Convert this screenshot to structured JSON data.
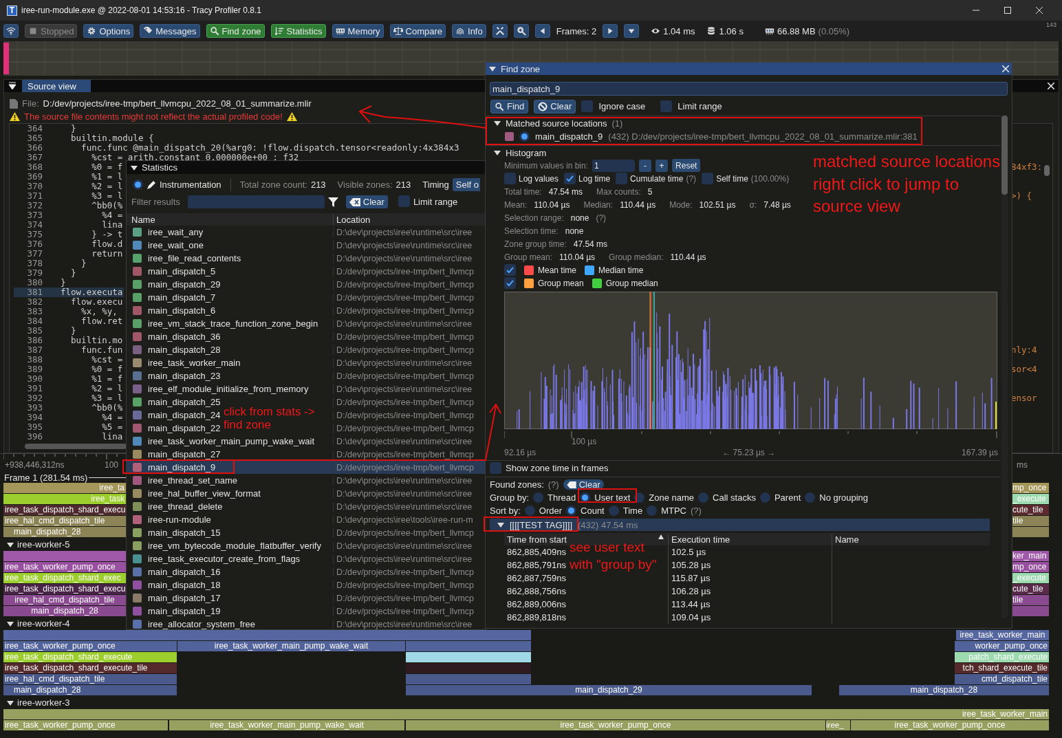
{
  "window": {
    "app_icon": "T",
    "title": "iree-run-module.exe @ 2022-08-01 14:53:16 - Tracy Profiler 0.8.1"
  },
  "toolbar": {
    "buttons": [
      {
        "kind": "icon",
        "active": false
      },
      {
        "kind": "label",
        "label": "Stopped",
        "active": false,
        "disabled": true
      },
      {
        "kind": "label",
        "label": "Options",
        "active": false
      },
      {
        "kind": "label",
        "label": "Messages",
        "active": false
      },
      {
        "kind": "label",
        "label": "Find zone",
        "active": true
      },
      {
        "kind": "label",
        "label": "Statistics",
        "active": true
      },
      {
        "kind": "label",
        "label": "Memory",
        "active": false
      },
      {
        "kind": "label",
        "label": "Compare",
        "active": false
      },
      {
        "kind": "label",
        "label": "Info",
        "active": false
      },
      {
        "kind": "icon",
        "active": false
      },
      {
        "kind": "icon",
        "active": false
      }
    ],
    "frames": "Frames: 2",
    "frame_time": "1.04 ms",
    "total_time": "1.06 s",
    "memory": "66.88 MB",
    "memory_share": "(0.05%)",
    "fps": "143"
  },
  "source_view": {
    "tab": "Source view",
    "file_label": "File:",
    "file_path": "D:/dev/projects/iree-tmp/bert_llvmcpu_2022_08_01_summarize.mlir",
    "warning": "The source file contents might not reflect the actual profiled code!",
    "lines": [
      {
        "number": "364",
        "code": "  }",
        "selected": false
      },
      {
        "number": "365",
        "code": "  builtin.module {",
        "selected": false
      },
      {
        "number": "366",
        "code": "    func.func @main_dispatch_20(%arg0: !flow.dispatch.tensor<readonly:4x384x3",
        "selected": false
      },
      {
        "number": "367",
        "code": "      %cst = arith.constant 0.000000e+00 : f32",
        "selected": false
      },
      {
        "number": "368",
        "code": "      %0 = f",
        "tail": "84xf3:",
        "selected": false
      },
      {
        "number": "369",
        "code": "      %1 = l",
        "selected": false
      },
      {
        "number": "370",
        "code": "      %2 = l",
        "selected": false
      },
      {
        "number": "371",
        "code": "      %3 = l",
        "tail": ">) {",
        "selected": false
      },
      {
        "number": "372",
        "code": "      ^bb0(%",
        "selected": false
      },
      {
        "number": "373",
        "code": "        %4 =",
        "selected": false
      },
      {
        "number": "374",
        "code": "        lina",
        "selected": false
      },
      {
        "number": "375",
        "code": "      } -> t",
        "selected": false
      },
      {
        "number": "376",
        "code": "      flow.d",
        "selected": false
      },
      {
        "number": "377",
        "code": "      return",
        "selected": false
      },
      {
        "number": "378",
        "code": "    }",
        "selected": false
      },
      {
        "number": "379",
        "code": "  }",
        "selected": false
      },
      {
        "number": "380",
        "code": "}",
        "selected": false
      },
      {
        "number": "381",
        "code": "flow.executa",
        "selected": true
      },
      {
        "number": "382",
        "code": "  flow.execu",
        "selected": false
      },
      {
        "number": "383",
        "code": "    %x, %y,",
        "selected": false
      },
      {
        "number": "384",
        "code": "    flow.ret",
        "selected": false
      },
      {
        "number": "385",
        "code": "  }",
        "selected": false
      },
      {
        "number": "386",
        "code": "  builtin.mo",
        "selected": false
      },
      {
        "number": "387",
        "code": "    func.fun",
        "tail": "nly:4",
        "selected": false
      },
      {
        "number": "388",
        "code": "      %cst =",
        "selected": false
      },
      {
        "number": "389",
        "code": "      %0 = f",
        "tail": "sor<4",
        "selected": false
      },
      {
        "number": "390",
        "code": "      %1 = f",
        "selected": false
      },
      {
        "number": "391",
        "code": "      %2 = l",
        "selected": false
      },
      {
        "number": "392",
        "code": "      %3 = l",
        "tail": "ensor",
        "selected": false
      },
      {
        "number": "393",
        "code": "      ^bb0(%",
        "selected": false
      },
      {
        "number": "394",
        "code": "        %4 =",
        "selected": false
      },
      {
        "number": "395",
        "code": "        %5 =",
        "selected": false
      },
      {
        "number": "396",
        "code": "        lina",
        "selected": false
      }
    ]
  },
  "statistics": {
    "title": "Statistics",
    "mode": {
      "label": "Instrumentation",
      "selected": true
    },
    "total_label": "Total zone count:",
    "total": "213",
    "visible_label": "Visible zones:",
    "visible": "213",
    "timing_label": "Timing",
    "timing_button": "Self o",
    "filter_label": "Filter results",
    "clear": "Clear",
    "limit_range": {
      "label": "Limit range",
      "checked": false
    },
    "columns": [
      "Name",
      "Location"
    ],
    "rows": [
      {
        "name": "iree_wait_any",
        "location": "D:\\dev\\projects\\iree\\runtime\\src\\iree",
        "color": "#5aa084",
        "selected": false
      },
      {
        "name": "iree_wait_one",
        "location": "D:\\dev\\projects\\iree\\runtime\\src\\iree",
        "color": "#5088b8",
        "selected": false
      },
      {
        "name": "iree_file_read_contents",
        "location": "D:\\dev\\projects\\iree\\runtime\\src\\iree",
        "color": "#58a06c",
        "selected": false
      },
      {
        "name": "main_dispatch_5",
        "location": "D:/dev/projects/iree-tmp/bert_llvmcp",
        "color": "#a05868",
        "selected": false
      },
      {
        "name": "main_dispatch_29",
        "location": "D:/dev/projects/iree-tmp/bert_llvmcp",
        "color": "#58a068",
        "selected": false
      },
      {
        "name": "main_dispatch_7",
        "location": "D:/dev/projects/iree-tmp/bert_llvmcp",
        "color": "#58a068",
        "selected": false
      },
      {
        "name": "main_dispatch_6",
        "location": "D:/dev/projects/iree-tmp/bert_llvmcp",
        "color": "#a05868",
        "selected": false
      },
      {
        "name": "iree_vm_stack_trace_function_zone_begin",
        "location": "D:\\dev\\projects\\iree\\runtime\\src\\iree",
        "color": "#58a068",
        "selected": false
      },
      {
        "name": "main_dispatch_36",
        "location": "D:/dev/projects/iree-tmp/bert_llvmcp",
        "color": "#a05868",
        "selected": false
      },
      {
        "name": "main_dispatch_28",
        "location": "D:/dev/projects/iree-tmp/bert_llvmcp",
        "color": "#7a6080",
        "selected": false
      },
      {
        "name": "iree_task_worker_main",
        "location": "D:\\dev\\projects\\iree\\runtime\\src\\iree",
        "color": "#9a8a70",
        "selected": false
      },
      {
        "name": "main_dispatch_23",
        "location": "D:/dev/projects/iree-tmp/bert_llvmcp",
        "color": "#5a7090",
        "selected": false
      },
      {
        "name": "iree_elf_module_initialize_from_memory",
        "location": "D:\\dev\\projects\\iree\\runtime\\src\\iree",
        "color": "#7a6088",
        "selected": false
      },
      {
        "name": "main_dispatch_25",
        "location": "D:/dev/projects/iree-tmp/bert_llvmcp",
        "color": "#58a068",
        "selected": false
      },
      {
        "name": "main_dispatch_24",
        "location": "D:/dev/projects/iree-tmp/bert_llvmcp",
        "color": "#6a6a98",
        "selected": false
      },
      {
        "name": "main_dispatch_22",
        "location": "D:/dev/projects/iree-tmp/bert_llvmcp",
        "color": "#a05870",
        "selected": false
      },
      {
        "name": "iree_task_worker_main_pump_wake_wait",
        "location": "D:\\dev\\projects\\iree\\runtime\\src\\iree",
        "color": "#5088b8",
        "selected": false
      },
      {
        "name": "main_dispatch_27",
        "location": "D:/dev/projects/iree-tmp/bert_llvmcp",
        "color": "#9a8a60",
        "selected": false
      },
      {
        "name": "main_dispatch_9",
        "location": "D:/dev/projects/iree-tmp/bert_llvmcp",
        "color": "#b0607a",
        "selected": true
      },
      {
        "name": "iree_thread_set_name",
        "location": "D:\\dev\\projects\\iree\\runtime\\src\\iree",
        "color": "#a05880",
        "selected": false
      },
      {
        "name": "iree_hal_buffer_view_format",
        "location": "D:\\dev\\projects\\iree\\runtime\\src\\iree",
        "color": "#9a8a60",
        "selected": false
      },
      {
        "name": "iree_thread_delete",
        "location": "D:\\dev\\projects\\iree\\runtime\\src\\iree",
        "color": "#80905a",
        "selected": false
      },
      {
        "name": "iree-run-module",
        "location": "D:\\dev\\projects\\iree\\tools\\iree-run-m",
        "color": "#b0607a",
        "selected": false
      },
      {
        "name": "main_dispatch_15",
        "location": "D:/dev/projects/iree-tmp/bert_llvmcp",
        "color": "#8aa060",
        "selected": false
      },
      {
        "name": "iree_vm_bytecode_module_flatbuffer_verify",
        "location": "D:\\dev\\projects\\iree\\runtime\\src\\iree",
        "color": "#8aa060",
        "selected": false
      },
      {
        "name": "iree_task_executor_create_from_flags",
        "location": "D:\\dev\\projects\\iree\\runtime\\src\\iree",
        "color": "#4a9090",
        "selected": false
      },
      {
        "name": "main_dispatch_16",
        "location": "D:/dev/projects/iree-tmp/bert_llvmcp",
        "color": "#5a70a8",
        "selected": false
      },
      {
        "name": "main_dispatch_18",
        "location": "D:/dev/projects/iree-tmp/bert_llvmcp",
        "color": "#9050a0",
        "selected": false
      },
      {
        "name": "main_dispatch_17",
        "location": "D:/dev/projects/iree-tmp/bert_llvmcp",
        "color": "#8a7a68",
        "selected": false
      },
      {
        "name": "main_dispatch_19",
        "location": "D:/dev/projects/iree-tmp/bert_llvmcp",
        "color": "#9050a0",
        "selected": false
      },
      {
        "name": "iree_allocator_system_free",
        "location": "D:\\dev\\projects\\iree\\runtime\\src\\iree",
        "color": "#5a70a8",
        "selected": false
      }
    ]
  },
  "find_zone": {
    "title": "Find zone",
    "query": "main_dispatch_9",
    "find": "Find",
    "clear": "Clear",
    "ignore_case": {
      "label": "Ignore case",
      "checked": false
    },
    "limit_range": {
      "label": "Limit range",
      "checked": false
    },
    "matched": {
      "label": "Matched source locations",
      "count": "(1)",
      "expanded": true,
      "items": [
        {
          "name": "main_dispatch_9",
          "detail": "(432) D:/dev/projects/iree-tmp/bert_llvmcpu_2022_08_01_summarize.mlir:381",
          "color": "#a05a80",
          "selected": true
        }
      ]
    },
    "histogram": {
      "label": "Histogram",
      "expanded": true,
      "min_label": "Minimum values in bin:",
      "min_value": "1",
      "minus": "-",
      "plus": "+",
      "reset": "Reset",
      "options": [
        {
          "label": "Log values",
          "checked": false
        },
        {
          "label": "Log time",
          "checked": true
        },
        {
          "label": "Cumulate time",
          "checked": false,
          "hint": "(?)"
        },
        {
          "label": "Self time",
          "checked": false,
          "hint": "(100.00%)"
        }
      ],
      "stats": [
        [
          {
            "label": "Total time:",
            "value": "47.54 ms"
          },
          {
            "label": "Max counts:",
            "value": "5"
          }
        ],
        [
          {
            "label": "Mean:",
            "value": "110.04 µs"
          },
          {
            "label": "Median:",
            "value": "110.44 µs"
          },
          {
            "label": "Mode:",
            "value": "102.51 µs"
          },
          {
            "label": "σ:",
            "value": "7.48 µs"
          }
        ],
        [
          {
            "label": "Selection range:",
            "value": "none",
            "hint": "(?)"
          }
        ],
        [
          {
            "label": "Selection time:",
            "value": "none"
          }
        ],
        [
          {
            "label": "Zone group time:",
            "value": "47.54 ms"
          }
        ],
        [
          {
            "label": "Group mean:",
            "value": "110.04 µs"
          },
          {
            "label": "Group median:",
            "value": "110.44 µs"
          }
        ]
      ],
      "legend": [
        {
          "checked": true,
          "items": [
            {
              "label": "Mean time",
              "color": "#ff4a4a"
            },
            {
              "label": "Median time",
              "color": "#40a8ff"
            }
          ]
        },
        {
          "checked": true,
          "items": [
            {
              "label": "Group mean",
              "color": "#ffa040"
            },
            {
              "label": "Group median",
              "color": "#40d040"
            }
          ]
        }
      ],
      "tick": "100 µs",
      "min": "92.16 µs",
      "range": "← 75.23 µs →",
      "max": "167.39 µs"
    },
    "show_zone_time": {
      "label": "Show zone time in frames",
      "checked": false
    },
    "found_label": "Found zones:",
    "found_hint": "(?)",
    "found_clear": "Clear",
    "group_by": {
      "label": "Group by:",
      "options": [
        {
          "label": "Thread",
          "selected": false
        },
        {
          "label": "User text",
          "selected": true
        },
        {
          "label": "Zone name",
          "selected": false
        },
        {
          "label": "Call stacks",
          "selected": false
        },
        {
          "label": "Parent",
          "selected": false
        },
        {
          "label": "No grouping",
          "selected": false
        }
      ]
    },
    "sort_by": {
      "label": "Sort by:",
      "hint": "(?)",
      "options": [
        {
          "label": "Order",
          "selected": false
        },
        {
          "label": "Count",
          "selected": true
        },
        {
          "label": "Time",
          "selected": false
        },
        {
          "label": "MTPC",
          "selected": false
        }
      ]
    },
    "group": {
      "label": "[[[[TEST TAG]]]]",
      "count": "(432) 47.54 ms",
      "expanded": true
    },
    "columns": [
      {
        "label": "Time from start",
        "sorted": true
      },
      {
        "label": "Execution time",
        "sorted": false
      },
      {
        "label": "Name",
        "sorted": false
      }
    ],
    "rows": [
      {
        "time": "862,885,409ns",
        "duration": "102.5 µs"
      },
      {
        "time": "862,885,791ns",
        "duration": "105.28 µs"
      },
      {
        "time": "862,887,759ns",
        "duration": "115.87 µs"
      },
      {
        "time": "862,888,756ns",
        "duration": "106.28 µs"
      },
      {
        "time": "862,889,006ns",
        "duration": "113.44 µs"
      },
      {
        "time": "862,889,818ns",
        "duration": "109.04 µs"
      }
    ]
  },
  "timeline": {
    "ruler_start": "+938,446,312ns",
    "ruler_tick": "100",
    "ruler_unit": "ms",
    "frame": "Frame 1 (281.54 ms)",
    "threads": [
      {
        "lanes": [
          {
            "segments": [
              {
                "label": "iree_ta",
                "color": "#a5975a"
              },
              {
                "label": "mp_once",
                "color": "#a5975a"
              }
            ]
          },
          {
            "segments": [
              {
                "label": "iree_task",
                "color": "#9ccf2e"
              },
              {
                "label": "_execute",
                "color": "#9edab0"
              }
            ]
          },
          {
            "segments": [
              {
                "label": "iree_task_dispatch_shard_execu",
                "color": "#4e2a2e"
              },
              {
                "label": "cute_tile",
                "color": "#5a2a2e"
              }
            ]
          },
          {
            "segments": [
              {
                "label": "iree_hal_cmd_dispatch_tile",
                "color": "#8c8456"
              },
              {
                "label": "tile",
                "color": "#8c8456"
              }
            ]
          },
          {
            "segments": [
              {
                "label": "main_dispatch_28",
                "color": "#8c8456"
              },
              {
                "color": "#8c8456"
              }
            ]
          }
        ]
      },
      {
        "name": "iree-worker-5",
        "expanded": true,
        "lanes": [
          {
            "segments": [
              {
                "color": "#a058a8"
              },
              {
                "label": "ker_main",
                "color": "#a058a8"
              }
            ]
          },
          {
            "segments": [
              {
                "label": "iree_task_worker_pump_once",
                "color": "#9a50a0"
              },
              {
                "label": "mp_once",
                "color": "#9a50a0"
              }
            ]
          },
          {
            "segments": [
              {
                "label": "iree_task_dispatch_shard_exec",
                "color": "#9ccf2e"
              },
              {
                "label": "_execute",
                "color": "#9edab0"
              }
            ]
          },
          {
            "segments": [
              {
                "label": "iree_task_dispatch_shard_execu",
                "color": "#4a2448"
              },
              {
                "label": "cute_tile",
                "color": "#5a2a4a"
              }
            ]
          },
          {
            "segments": [
              {
                "label": "iree_hal_cmd_dispatch_tile",
                "color": "#8a4a90"
              },
              {
                "label": "tile",
                "color": "#8a4a90"
              }
            ]
          },
          {
            "segments": [
              {
                "label": "main_dispatch_28",
                "color": "#8a4a90"
              },
              {
                "color": "#8a4a90"
              }
            ]
          }
        ]
      },
      {
        "name": "iree-worker-4",
        "expanded": true,
        "lanes": [
          {
            "segments": [
              {
                "color": "#5566a0"
              },
              {
                "label": "iree_task_worker_main",
                "color": "#5566a0"
              }
            ]
          },
          {
            "segments": [
              {
                "label": "iree_task_worker_pump_once",
                "color": "#52629a"
              },
              {
                "label": "iree_task_worker_main_pump_wake_wait",
                "color": "#52629a"
              },
              {
                "color": "#52629a"
              },
              {
                "label": "worker_pump_once",
                "color": "#52629a"
              }
            ]
          },
          {
            "segments": [
              {
                "label": "iree_task_dispatch_shard_execute",
                "color": "#9ccf2e"
              },
              {
                "color": "#a0d8e8"
              },
              {
                "label": "patch_shard_execute",
                "color": "#9edab0"
              }
            ]
          },
          {
            "segments": [
              {
                "label": "iree_task_dispatch_shard_execute_tile",
                "color": "#552a2c"
              },
              {
                "color": "#2e1a20"
              },
              {
                "label": "tch_shard_execute_tile",
                "color": "#552a2c"
              }
            ]
          },
          {
            "segments": [
              {
                "label": "iree_hal_cmd_dispatch_tile",
                "color": "#4a5a8c"
              },
              {
                "color": "#4a5a8c"
              },
              {
                "label": "cmd_dispatch_tile",
                "color": "#4a5a8c"
              }
            ]
          },
          {
            "segments": [
              {
                "label": "main_dispatch_28",
                "color": "#4a5a8c"
              },
              {
                "label": "main_dispatch_29",
                "color": "#4a5a8c"
              },
              {
                "label": "main_dispatch_28",
                "color": "#4a5a8c"
              }
            ]
          }
        ]
      },
      {
        "name": "iree-worker-3",
        "expanded": true,
        "lanes": [
          {
            "segments": [
              {
                "label": "iree_task_worker_main",
                "color": "#98a060"
              }
            ]
          },
          {
            "segments": [
              {
                "label": "iree_task_worker_pump_once",
                "color": "#98a060"
              },
              {
                "label": "iree_task_worker_main_pump_wake_wait",
                "color": "#98a060"
              },
              {
                "label": "iree_task_worker_pump_once",
                "color": "#98a060"
              },
              {
                "label": "iree_",
                "color": "#98a060"
              },
              {
                "label": "iree_task_worker_pump_once",
                "color": "#98a060"
              }
            ]
          }
        ]
      }
    ]
  },
  "annotations": [
    {
      "text": "matched source locations"
    },
    {
      "text": "right click to jump to"
    },
    {
      "text": "source view"
    },
    {
      "text": "click from stats -> find zone"
    },
    {
      "text": "see user text"
    },
    {
      "text": "with \"group by\""
    }
  ]
}
